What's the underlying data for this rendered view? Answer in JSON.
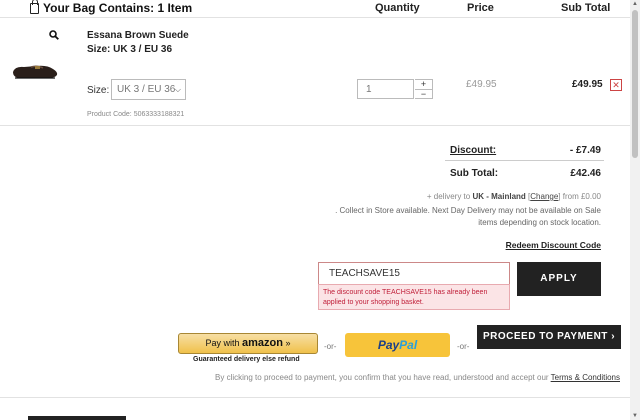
{
  "header": {
    "title": "Your Bag Contains: 1 Item",
    "col_quantity": "Quantity",
    "col_price": "Price",
    "col_subtotal": "Sub Total"
  },
  "item": {
    "name": "Essana Brown Suede",
    "size_text": "Size: UK 3 / EU 36",
    "size_label": "Size:",
    "size_selected": "UK 3 / EU 36",
    "product_code": "Product Code: 5063333188321",
    "quantity": "1",
    "price": "£49.95",
    "subtotal": "£49.95"
  },
  "summary": {
    "discount_label": "Discount:",
    "discount_value": "- £7.49",
    "subtotal_label": "Sub Total:",
    "subtotal_value": "£42.46",
    "delivery_prefix": "+ delivery to",
    "delivery_region": "UK - Mainland",
    "change_link": "Change",
    "delivery_price": "from £0.00",
    "collect_note": ". Collect in Store available. Next Day Delivery may not be available on Sale items depending on stock location.",
    "redeem_link": "Redeem Discount Code"
  },
  "discount": {
    "code_value": "TEACHSAVE15",
    "error": "The discount code TEACHSAVE15 has already been applied to your shopping basket.",
    "apply_label": "APPLY"
  },
  "checkout": {
    "amazon_label": "Pay with",
    "amazon_brand": "amazon",
    "amazon_sub": "Guaranteed delivery else refund",
    "or_text": "-or-",
    "paypal_a": "Pay",
    "paypal_b": "Pal",
    "proceed_label": "PROCEED TO PAYMENT ›",
    "terms_text": "By clicking to proceed to payment, you confirm that you have read, understood and accept our",
    "terms_link": "Terms & Conditions"
  },
  "colors": {
    "error_bg": "#fbe4e6",
    "error_text": "#c0203a",
    "button_dark": "#222222",
    "paypal_yellow": "#f7c43a"
  }
}
